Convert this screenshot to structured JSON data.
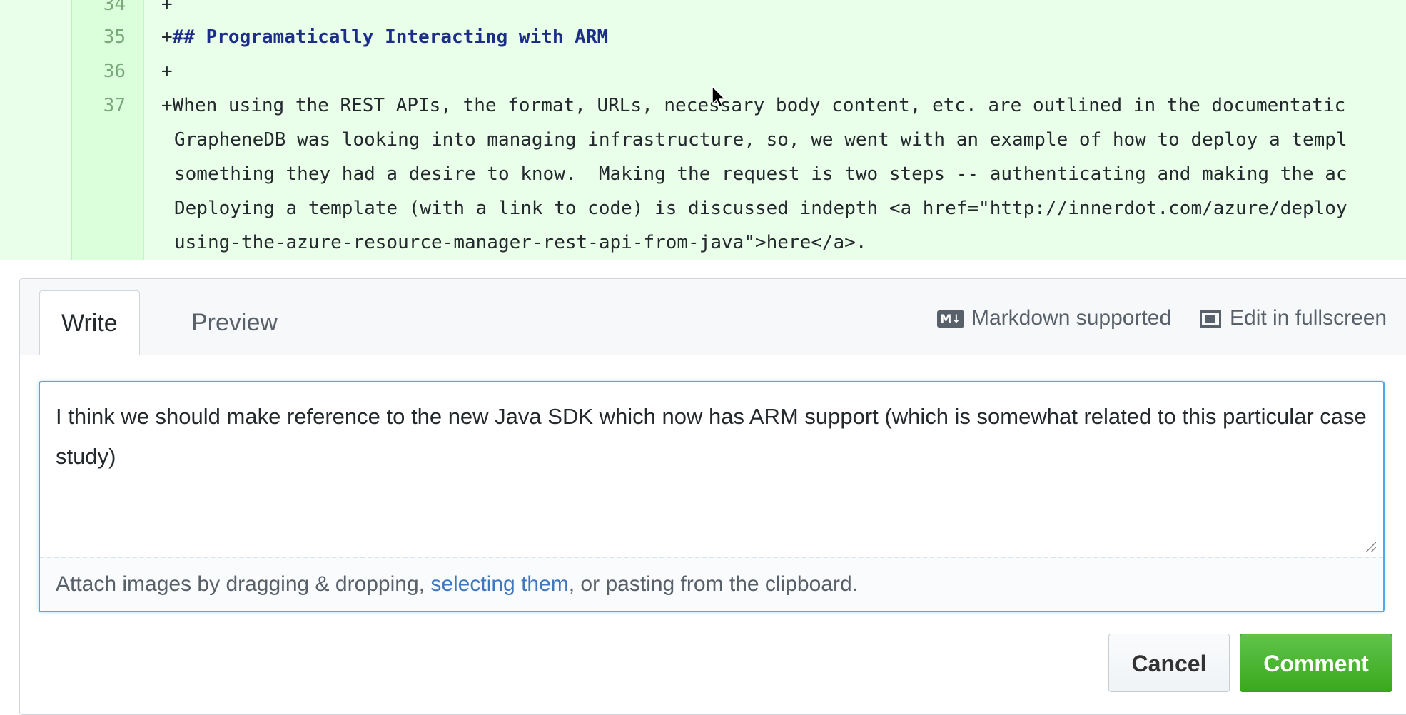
{
  "diff": {
    "lines": [
      {
        "num": "34",
        "text": "+"
      },
      {
        "num": "35",
        "prefix": "+",
        "heading": "## Programatically Interacting with ARM"
      },
      {
        "num": "36",
        "text": "+"
      },
      {
        "num": "37",
        "text": "+When using the REST APIs, the format, URLs, necessary body content, etc. are outlined in the documentatic"
      }
    ],
    "continuation": [
      "GrapheneDB was looking into managing infrastructure, so, we went with an example of how to deploy a templ",
      "something they had a desire to know.  Making the request is two steps -- authenticating and making the ac",
      "Deploying a template (with a link to code) is discussed indepth <a href=\"http://innerdot.com/azure/deploy",
      "using-the-azure-resource-manager-rest-api-from-java\">here</a>."
    ]
  },
  "comment": {
    "tabs": {
      "write": "Write",
      "preview": "Preview"
    },
    "markdown_label": "Markdown supported",
    "markdown_icon": "M↓",
    "fullscreen_label": "Edit in fullscreen",
    "text": "I think we should make reference to the new Java SDK which now has ARM support (which is somewhat related to this particular case study)",
    "attach": {
      "before": "Attach images by dragging & dropping, ",
      "link": "selecting them",
      "after": ", or pasting from the clipboard."
    },
    "cancel": "Cancel",
    "submit": "Comment"
  }
}
